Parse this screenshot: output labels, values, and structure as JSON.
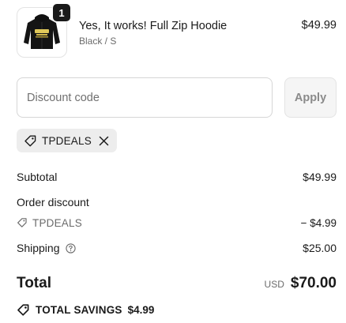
{
  "line_item": {
    "quantity": "1",
    "title": "Yes, It works! Full Zip Hoodie",
    "variant": "Black / S",
    "price": "$49.99",
    "thumbnail_icon": "hoodie-icon"
  },
  "discount": {
    "placeholder": "Discount code",
    "apply_label": "Apply",
    "applied_code": "TPDEALS"
  },
  "summary": {
    "subtotal_label": "Subtotal",
    "subtotal_value": "$49.99",
    "order_discount_label": "Order discount",
    "discount_code": "TPDEALS",
    "discount_value": "− $4.99",
    "shipping_label": "Shipping",
    "shipping_value": "$25.00",
    "total_label": "Total",
    "currency": "USD",
    "total_value": "$70.00",
    "savings_label": "TOTAL SAVINGS",
    "savings_value": "$4.99"
  },
  "colors": {
    "text": "#1a1a1a",
    "muted": "#6b6b6b",
    "chip_bg": "#ededed",
    "apply_bg": "#f5f5f5",
    "border": "#d6d6d6"
  }
}
